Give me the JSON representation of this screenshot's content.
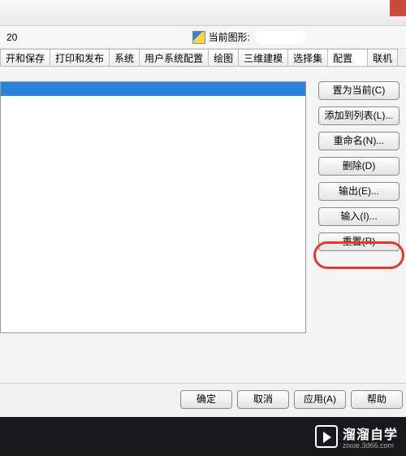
{
  "header": {
    "left_text": "20",
    "drawing_label": "当前图形:"
  },
  "tabs": [
    "开和保存",
    "打印和发布",
    "系统",
    "用户系统配置",
    "绘图",
    "三维建模",
    "选择集",
    "配置",
    "联机"
  ],
  "active_tab_index": 7,
  "side_buttons": {
    "set_current": "置为当前(C)",
    "add_to_list": "添加到列表(L)...",
    "rename": "重命名(N)...",
    "delete": "删除(D)",
    "export": "输出(E)...",
    "import": "输入(I)...",
    "reset": "重置(R)"
  },
  "bottom_buttons": {
    "ok": "确定",
    "cancel": "取消",
    "apply": "应用(A)",
    "help": "帮助"
  },
  "footer": {
    "main": "溜溜自学",
    "sub": "zixue.3d66.com"
  }
}
